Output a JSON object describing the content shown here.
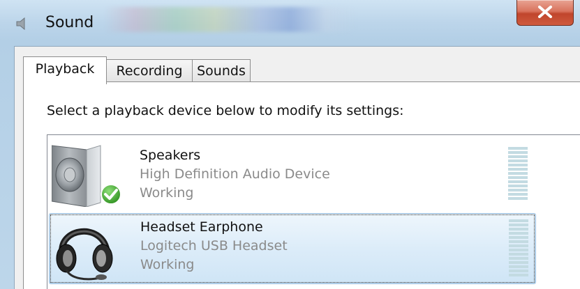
{
  "window": {
    "title": "Sound",
    "close_icon": "close-x-icon",
    "title_icon": "speaker-icon"
  },
  "tabs": [
    {
      "label": "Playback",
      "active": true
    },
    {
      "label": "Recording",
      "active": false
    },
    {
      "label": "Sounds",
      "active": false
    }
  ],
  "instruction": "Select a playback device below to modify its settings:",
  "devices": [
    {
      "name": "Speakers",
      "description": "High Definition Audio Device",
      "status": "Working",
      "icon": "speaker-device-icon",
      "badge_icon": "default-device-check-icon",
      "selected": false
    },
    {
      "name": "Headset Earphone",
      "description": "Logitech USB Headset",
      "status": "Working",
      "icon": "headset-device-icon",
      "selected": true
    }
  ],
  "colors": {
    "accent_selection": "#cfe5f6",
    "meter": "#c3dbe2",
    "close_button": "#c0452c"
  }
}
